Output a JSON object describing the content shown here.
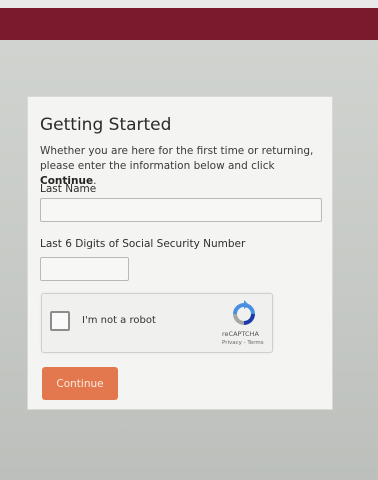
{
  "page": {
    "title": "Getting Started",
    "intro_text": "Whether you are here for the first time or returning, please enter the information below and click ",
    "intro_emphasis": "Continue",
    "intro_end": "."
  },
  "form": {
    "last_name_label": "Last Name",
    "last_name_value": "",
    "ssn_label": "Last 6 Digits of Social Security Number",
    "ssn_value": "",
    "continue_label": "Continue"
  },
  "recaptcha": {
    "checkbox_label": "I'm not a robot",
    "brand": "reCAPTCHA",
    "links": "Privacy - Terms",
    "logo_icon": "recaptcha-logo-icon"
  },
  "colors": {
    "header_bar": "#7a1a2c",
    "button": "#e3784e",
    "card_bg": "#f4f4f2"
  }
}
